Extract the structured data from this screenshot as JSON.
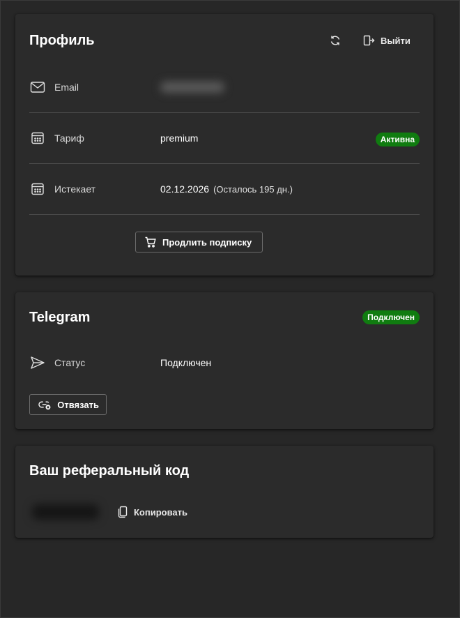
{
  "profile": {
    "title": "Профиль",
    "refresh_icon": "refresh-icon",
    "logout_label": "Выйти",
    "rows": [
      {
        "label": "Email",
        "value": "",
        "icon": "mail-icon"
      },
      {
        "label": "Тариф",
        "value": "premium",
        "icon": "calendar-icon",
        "badge": "Активна"
      },
      {
        "label": "Истекает",
        "value": "02.12.2026",
        "extra": "(Осталось 195 дн.)",
        "icon": "calendar-icon"
      }
    ],
    "renew_label": "Продлить подписку"
  },
  "telegram": {
    "title": "Telegram",
    "badge": "Подключен",
    "status_label": "Статус",
    "status_value": "Подключен",
    "unlink_label": "Отвязать"
  },
  "referral": {
    "title": "Ваш реферальный код",
    "copy_label": "Копировать"
  },
  "colors": {
    "background": "#272727",
    "card": "#2b2b2b",
    "success": "#107c10",
    "divider": "#4a4a4a"
  }
}
